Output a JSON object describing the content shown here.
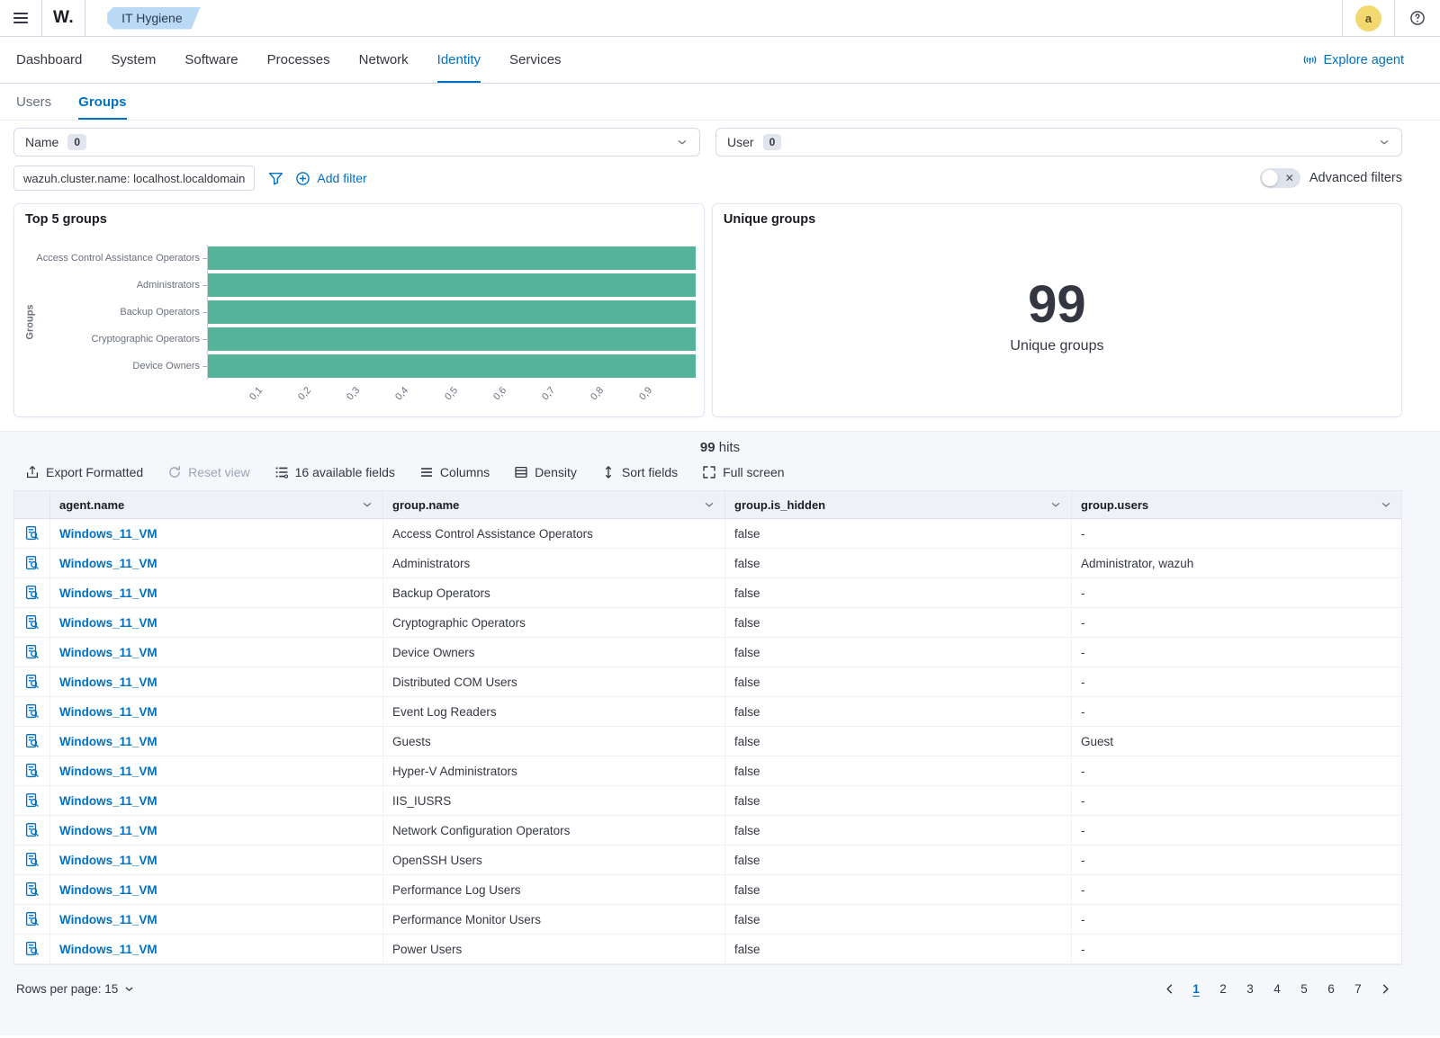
{
  "header": {
    "logo_text": "W.",
    "breadcrumb_tag": "IT Hygiene",
    "avatar_letter": "a"
  },
  "nav": {
    "tabs": [
      {
        "label": "Dashboard",
        "active": false
      },
      {
        "label": "System",
        "active": false
      },
      {
        "label": "Software",
        "active": false
      },
      {
        "label": "Processes",
        "active": false
      },
      {
        "label": "Network",
        "active": false
      },
      {
        "label": "Identity",
        "active": true
      },
      {
        "label": "Services",
        "active": false
      }
    ],
    "explore_agent_label": "Explore agent"
  },
  "subnav": {
    "tabs": [
      {
        "label": "Users",
        "active": false
      },
      {
        "label": "Groups",
        "active": true
      }
    ]
  },
  "filters": {
    "selects": [
      {
        "label": "Name",
        "count": "0"
      },
      {
        "label": "User",
        "count": "0"
      }
    ],
    "filter_pill": "wazuh.cluster.name: localhost.localdomain",
    "add_filter_label": "Add filter",
    "advanced_filters_label": "Advanced filters"
  },
  "chart_data": {
    "type": "bar",
    "orientation": "horizontal",
    "title": "Top 5 groups",
    "categories": [
      "Access Control Assistance Operators",
      "Administrators",
      "Backup Operators",
      "Cryptographic Operators",
      "Device Owners"
    ],
    "values": [
      1,
      1,
      1,
      1,
      1
    ],
    "xlim": [
      0,
      1
    ],
    "xticks": [
      0.1,
      0.2,
      0.3,
      0.4,
      0.5,
      0.6,
      0.7,
      0.8,
      0.9
    ],
    "xtick_labels": [
      "0,1",
      "0,2",
      "0,3",
      "0,4",
      "0,5",
      "0,6",
      "0,7",
      "0,8",
      "0,9"
    ],
    "xlabel": "",
    "ylabel": "Groups",
    "bar_color": "#54b399",
    "grid": false,
    "legend": "none"
  },
  "metric_panel": {
    "title": "Unique groups",
    "value": "99",
    "caption": "Unique groups"
  },
  "results": {
    "hits_count": "99",
    "hits_label": "hits",
    "toolbar": [
      {
        "label": "Export Formatted",
        "icon": "export-icon",
        "disabled": false
      },
      {
        "label": "Reset view",
        "icon": "refresh-icon",
        "disabled": true
      },
      {
        "label": "16 available fields",
        "icon": "fields-icon",
        "disabled": false
      },
      {
        "label": "Columns",
        "icon": "columns-icon",
        "disabled": false
      },
      {
        "label": "Density",
        "icon": "density-icon",
        "disabled": false
      },
      {
        "label": "Sort fields",
        "icon": "sort-icon",
        "disabled": false
      },
      {
        "label": "Full screen",
        "icon": "fullscreen-icon",
        "disabled": false
      }
    ],
    "columns": [
      "agent.name",
      "group.name",
      "group.is_hidden",
      "group.users"
    ],
    "rows": [
      {
        "agent": "Windows_11_VM",
        "group": "Access Control Assistance Operators",
        "hidden": "false",
        "users": "-"
      },
      {
        "agent": "Windows_11_VM",
        "group": "Administrators",
        "hidden": "false",
        "users": "Administrator, wazuh"
      },
      {
        "agent": "Windows_11_VM",
        "group": "Backup Operators",
        "hidden": "false",
        "users": "-"
      },
      {
        "agent": "Windows_11_VM",
        "group": "Cryptographic Operators",
        "hidden": "false",
        "users": "-"
      },
      {
        "agent": "Windows_11_VM",
        "group": "Device Owners",
        "hidden": "false",
        "users": "-"
      },
      {
        "agent": "Windows_11_VM",
        "group": "Distributed COM Users",
        "hidden": "false",
        "users": "-"
      },
      {
        "agent": "Windows_11_VM",
        "group": "Event Log Readers",
        "hidden": "false",
        "users": "-"
      },
      {
        "agent": "Windows_11_VM",
        "group": "Guests",
        "hidden": "false",
        "users": "Guest"
      },
      {
        "agent": "Windows_11_VM",
        "group": "Hyper-V Administrators",
        "hidden": "false",
        "users": "-"
      },
      {
        "agent": "Windows_11_VM",
        "group": "IIS_IUSRS",
        "hidden": "false",
        "users": "-"
      },
      {
        "agent": "Windows_11_VM",
        "group": "Network Configuration Operators",
        "hidden": "false",
        "users": "-"
      },
      {
        "agent": "Windows_11_VM",
        "group": "OpenSSH Users",
        "hidden": "false",
        "users": "-"
      },
      {
        "agent": "Windows_11_VM",
        "group": "Performance Log Users",
        "hidden": "false",
        "users": "-"
      },
      {
        "agent": "Windows_11_VM",
        "group": "Performance Monitor Users",
        "hidden": "false",
        "users": "-"
      },
      {
        "agent": "Windows_11_VM",
        "group": "Power Users",
        "hidden": "false",
        "users": "-"
      }
    ],
    "rows_per_page_label": "Rows per page: 15",
    "pagination": {
      "pages": [
        "1",
        "2",
        "3",
        "4",
        "5",
        "6",
        "7"
      ],
      "active_page": "1"
    }
  },
  "colors": {
    "primary_blue": "#0071c2",
    "bar_teal": "#54b399",
    "avatar_yellow": "#f1d86f",
    "tag_blue": "#b9d9f4"
  }
}
